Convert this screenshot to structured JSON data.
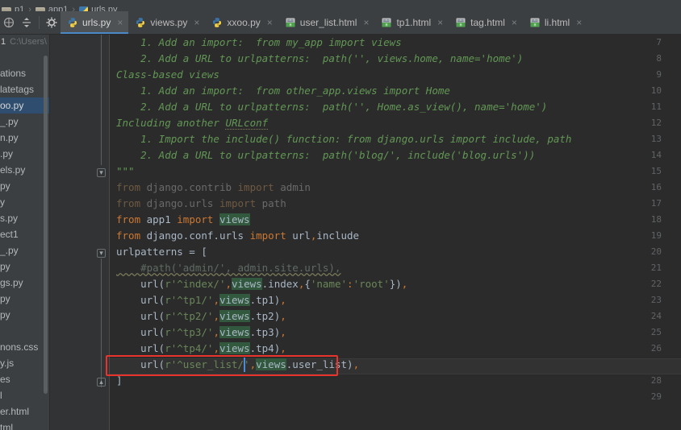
{
  "window": {
    "accent_color": "#4a88c7",
    "editor_bg": "#2b2b2b",
    "chrome_bg": "#3c3f41",
    "highlight_box_color": "#e8342c"
  },
  "breadcrumb": {
    "items": [
      {
        "label": "p1",
        "icon": "folder-icon"
      },
      {
        "label": "app1",
        "icon": "folder-icon"
      },
      {
        "label": "urls.py",
        "icon": "python-file-icon"
      }
    ],
    "separator": "›"
  },
  "toolbar": {
    "buttons": [
      {
        "name": "navigate-icon",
        "label": ""
      },
      {
        "name": "expand-collapse-icon",
        "label": ""
      },
      {
        "name": "settings-gear-icon",
        "label": ""
      }
    ]
  },
  "tabs": [
    {
      "label": "urls.py",
      "icon": "python-file-icon",
      "active": true,
      "close": "×"
    },
    {
      "label": "views.py",
      "icon": "python-file-icon",
      "active": false,
      "close": "×"
    },
    {
      "label": "xxoo.py",
      "icon": "python-file-icon",
      "active": false,
      "close": "×"
    },
    {
      "label": "user_list.html",
      "icon": "html-file-icon",
      "active": false,
      "close": "×"
    },
    {
      "label": "tp1.html",
      "icon": "html-file-icon",
      "active": false,
      "close": "×"
    },
    {
      "label": "tag.html",
      "icon": "html-file-icon",
      "active": false,
      "close": "×"
    },
    {
      "label": "li.html",
      "icon": "html-file-icon",
      "active": false,
      "close": "×"
    }
  ],
  "sidebar": {
    "header": {
      "project": "1",
      "path": "C:\\Users\\"
    },
    "items": [
      {
        "label": "ations",
        "selected": false
      },
      {
        "label": "latetags",
        "selected": false
      },
      {
        "label": "oo.py",
        "selected": true
      },
      {
        "label": "_.py",
        "selected": false
      },
      {
        "label": "n.py",
        "selected": false
      },
      {
        "label": ".py",
        "selected": false
      },
      {
        "label": "els.py",
        "selected": false
      },
      {
        "label": "py",
        "selected": false
      },
      {
        "label": "y",
        "selected": false
      },
      {
        "label": "s.py",
        "selected": false
      },
      {
        "label": "ect1",
        "selected": false
      },
      {
        "label": "_.py",
        "selected": false
      },
      {
        "label": "py",
        "selected": false
      },
      {
        "label": "gs.py",
        "selected": false
      },
      {
        "label": "py",
        "selected": false
      },
      {
        "label": "py",
        "selected": false
      },
      {
        "label": "",
        "selected": false
      },
      {
        "label": "nons.css",
        "selected": false
      },
      {
        "label": "y.js",
        "selected": false
      },
      {
        "label": "es",
        "selected": false
      },
      {
        "label": "l",
        "selected": false
      },
      {
        "label": "er.html",
        "selected": false
      },
      {
        "label": "tml",
        "selected": false
      }
    ]
  },
  "editor": {
    "file": "urls.py",
    "caret_line": 27,
    "caret_column": 26,
    "first_visible_line": 7,
    "last_visible_line": 29,
    "lines": [
      {
        "n": 7,
        "text": "    1. Add an import:  from my_app import views"
      },
      {
        "n": 8,
        "text": "    2. Add a URL to urlpatterns:  path('', views.home, name='home')"
      },
      {
        "n": 9,
        "text": "Class-based views"
      },
      {
        "n": 10,
        "text": "    1. Add an import:  from other_app.views import Home"
      },
      {
        "n": 11,
        "text": "    2. Add a URL to urlpatterns:  path('', Home.as_view(), name='home')"
      },
      {
        "n": 12,
        "text": "Including another URLconf"
      },
      {
        "n": 13,
        "text": "    1. Import the include() function: from django.urls import include, path"
      },
      {
        "n": 14,
        "text": "    2. Add a URL to urlpatterns:  path('blog/', include('blog.urls'))"
      },
      {
        "n": 15,
        "text": "\"\"\""
      },
      {
        "n": 16,
        "text": "from django.contrib import admin"
      },
      {
        "n": 17,
        "text": "from django.urls import path"
      },
      {
        "n": 18,
        "text": "from app1 import views"
      },
      {
        "n": 19,
        "text": "from django.conf.urls import url,include"
      },
      {
        "n": 20,
        "text": "urlpatterns = ["
      },
      {
        "n": 21,
        "text": "    #path('admin/', admin.site.urls),"
      },
      {
        "n": 22,
        "text": "    url(r'^index/',views.index,{'name':'root'}),"
      },
      {
        "n": 23,
        "text": "    url(r'^tp1/',views.tp1),"
      },
      {
        "n": 24,
        "text": "    url(r'^tp2/',views.tp2),"
      },
      {
        "n": 25,
        "text": "    url(r'^tp3/',views.tp3),"
      },
      {
        "n": 26,
        "text": "    url(r'^tp4/',views.tp4),"
      },
      {
        "n": 27,
        "text": "    url(r'^user_list/',views.user_list),"
      },
      {
        "n": 28,
        "text": "]"
      },
      {
        "n": 29,
        "text": ""
      }
    ]
  },
  "annotation": {
    "type": "red-rectangle",
    "target_line": 27,
    "color": "#e8342c"
  }
}
